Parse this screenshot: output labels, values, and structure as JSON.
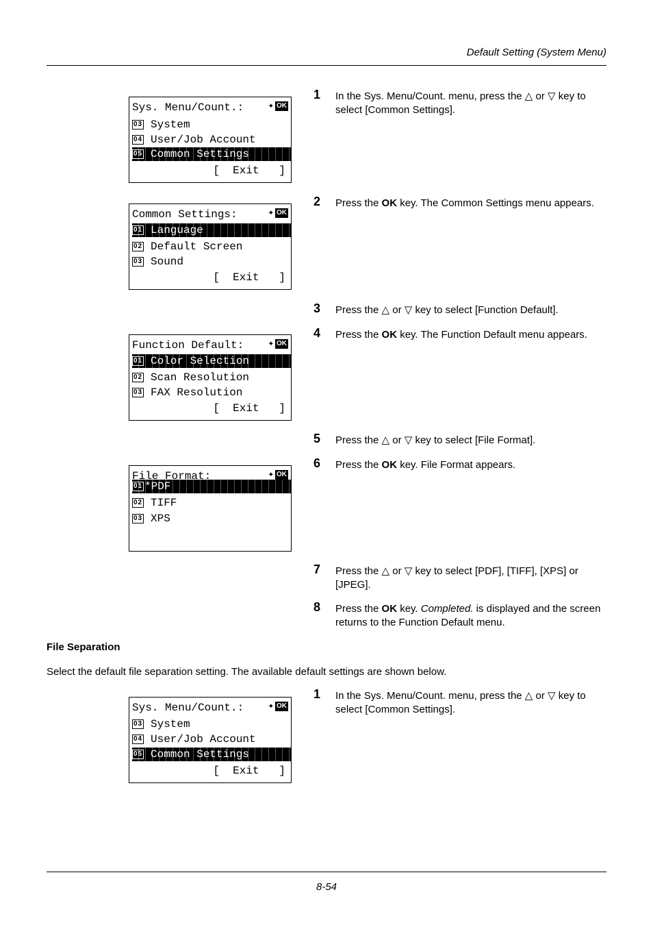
{
  "header": {
    "title": "Default Setting (System Menu)"
  },
  "footer": {
    "page": "8-54"
  },
  "icons": {
    "nav": "✧",
    "ok": "OK"
  },
  "screens": [
    {
      "title": "Sys. Menu/Count.:",
      "rows": [
        {
          "num": "03",
          "label": "System",
          "selected": false
        },
        {
          "num": "04",
          "label": "User/Job Account",
          "selected": false
        },
        {
          "num": "05",
          "label": "Common Settings",
          "selected": true
        }
      ],
      "exit": "[  Exit   ]"
    },
    {
      "title": "Common Settings:",
      "rows": [
        {
          "num": "01",
          "label": "Language",
          "selected": true
        },
        {
          "num": "02",
          "label": "Default Screen",
          "selected": false
        },
        {
          "num": "03",
          "label": "Sound",
          "selected": false
        }
      ],
      "exit": "[  Exit   ]"
    },
    {
      "title": "Function Default:",
      "rows": [
        {
          "num": "01",
          "label": "Color Selection",
          "selected": true
        },
        {
          "num": "02",
          "label": "Scan Resolution",
          "selected": false
        },
        {
          "num": "03",
          "label": "FAX Resolution",
          "selected": false
        }
      ],
      "exit": "[  Exit   ]"
    },
    {
      "title": "File Format:",
      "rows": [
        {
          "num": "01",
          "label": "*PDF",
          "selected": true
        },
        {
          "num": "02",
          "label": "TIFF",
          "selected": false
        },
        {
          "num": "03",
          "label": "XPS",
          "selected": false
        }
      ],
      "exit": ""
    },
    {
      "title": "Sys. Menu/Count.:",
      "rows": [
        {
          "num": "03",
          "label": "System",
          "selected": false
        },
        {
          "num": "04",
          "label": "User/Job Account",
          "selected": false
        },
        {
          "num": "05",
          "label": "Common Settings",
          "selected": true
        }
      ],
      "exit": "[  Exit   ]"
    }
  ],
  "steps": [
    {
      "num": "1",
      "html": "In the Sys. Menu/Count. menu, press the △ or ▽ key to select [Common Settings]."
    },
    {
      "num": "2",
      "html": "Press the <b>OK</b> key. The Common Settings menu appears."
    },
    {
      "num": "3",
      "html": "Press the △ or ▽ key to select [Function Default]."
    },
    {
      "num": "4",
      "html": "Press the <b>OK</b> key. The Function Default menu appears."
    },
    {
      "num": "5",
      "html": "Press the △ or ▽ key to select [File Format]."
    },
    {
      "num": "6",
      "html": "Press the <b>OK</b> key. File Format appears."
    },
    {
      "num": "7",
      "html": "Press the △ or ▽ key to select [PDF], [TIFF], [XPS] or [JPEG]."
    },
    {
      "num": "8",
      "html": "Press the <b>OK</b> key. <i>Completed.</i> is displayed and the screen returns to the Function Default menu."
    },
    {
      "num": "1",
      "html": "In the Sys. Menu/Count. menu, press the △ or ▽ key to select [Common Settings]."
    }
  ],
  "section": {
    "title": "File Separation",
    "intro": "Select the default file separation setting. The available default settings are shown below."
  }
}
